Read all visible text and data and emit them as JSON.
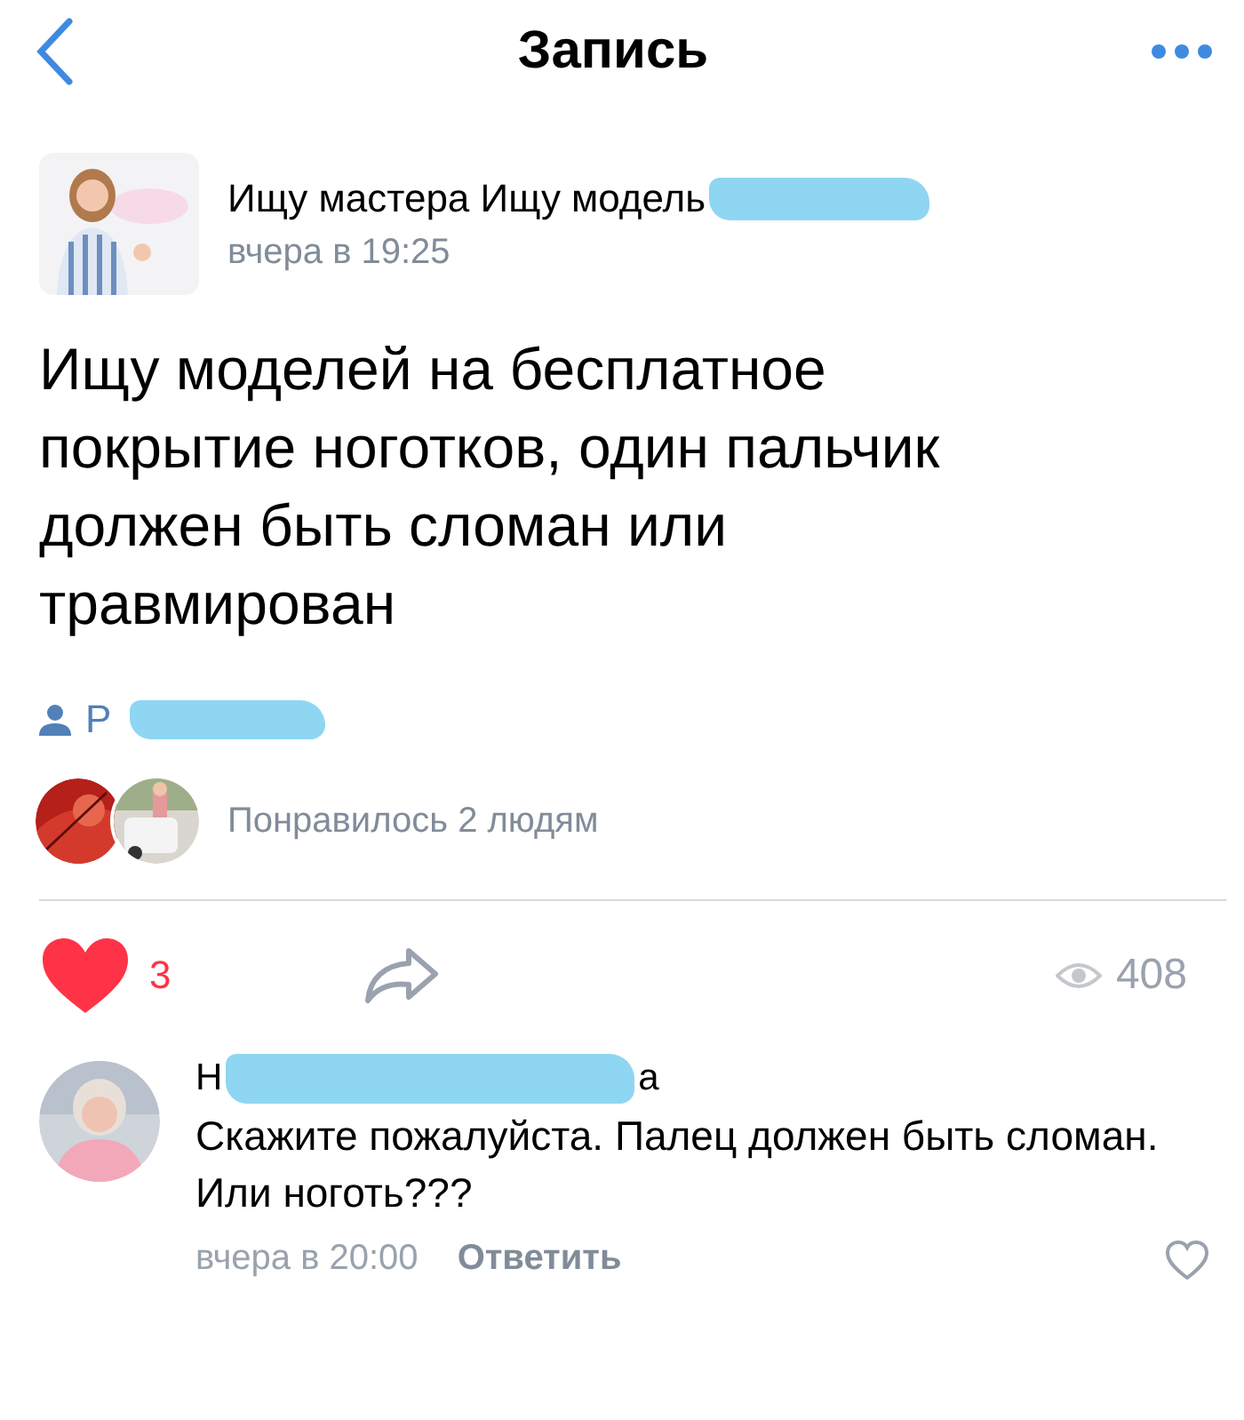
{
  "header": {
    "title": "Запись"
  },
  "post": {
    "author": "Ищу мастера Ищу модель",
    "time": "вчера в 19:25",
    "text": "Ищу моделей на бесплатное покрытие ноготков, один пальчик должен быть сломан или травмирован",
    "source": "Р",
    "liked_by": "Понравилось 2 людям",
    "likes": "3",
    "liked": true,
    "views": "408"
  },
  "comments": [
    {
      "author_start": "Н",
      "author_end": "а",
      "text": "Скажите пожалуйста. Палец должен быть сломан. Или ноготь???",
      "time": "вчера в 20:00",
      "reply": "Ответить",
      "liked": false
    }
  ]
}
